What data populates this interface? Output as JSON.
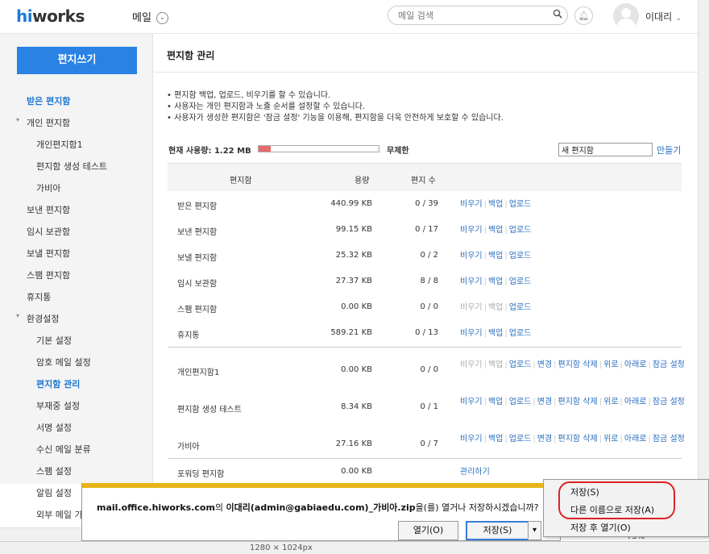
{
  "header": {
    "logo_hi": "hi",
    "logo_rest": "works",
    "mail_menu": "메일",
    "mail_menu_chevron": "chevron-down-icon",
    "search_placeholder": "메일 검색",
    "username": "이대리",
    "username_chevron": "⌄"
  },
  "sidebar": {
    "write_button": "편지쓰기",
    "items": [
      {
        "label": "받은 편지함",
        "level": 0,
        "active": true
      },
      {
        "label": "개인 편지함",
        "level": 0,
        "expander": "▾"
      },
      {
        "label": "개인편지함1",
        "level": 1
      },
      {
        "label": "편지함 생성 테스트",
        "level": 1
      },
      {
        "label": "가비아",
        "level": 1
      },
      {
        "label": "보낸 편지함",
        "level": 0
      },
      {
        "label": "임시 보관함",
        "level": 0
      },
      {
        "label": "보낼 편지함",
        "level": 0
      },
      {
        "label": "스팸 편지함",
        "level": 0
      },
      {
        "label": "휴지통",
        "level": 0
      },
      {
        "label": "환경설정",
        "level": 0,
        "expander": "▾"
      },
      {
        "label": "기본 설정",
        "level": 1
      },
      {
        "label": "암호 메일 설정",
        "level": 1
      },
      {
        "label": "편지함 관리",
        "level": 1,
        "active": true
      },
      {
        "label": "부재중 설정",
        "level": 1
      },
      {
        "label": "서명 설정",
        "level": 1
      },
      {
        "label": "수신 메일 분류",
        "level": 1
      },
      {
        "label": "스팸 설정",
        "level": 1
      },
      {
        "label": "알림 설정",
        "level": 1
      },
      {
        "label": "외부 메일 가",
        "level": 1
      }
    ]
  },
  "main": {
    "title": "편지함 관리",
    "notes": [
      "• 편지함 백업, 업로드, 비우기를 할 수 있습니다.",
      "• 사용자는 개인 편지함과 노출 순서를 설정할 수 있습니다.",
      "• 사용자가 생성한 편지함은 '잠금 설정' 기능을 이용해, 편지함을 더욱 안전하게 보호할 수 있습니다."
    ],
    "usage_label": "현재 사용량: 1.22 MB",
    "usage_fraction": 0.1,
    "unlimited": "무제한",
    "new_folder_value": "새 편지함",
    "make_link": "만들기",
    "columns": [
      "편지함",
      "용량",
      "편지 수"
    ],
    "rows": [
      {
        "name": "받은 편지함",
        "size": "440.99 KB",
        "count": "0 / 39",
        "actions": [
          {
            "t": "비우기",
            "on": true
          },
          {
            "t": "백업",
            "on": true
          },
          {
            "t": "업로드",
            "on": true
          }
        ]
      },
      {
        "name": "보낸 편지함",
        "size": "99.15 KB",
        "count": "0 / 17",
        "actions": [
          {
            "t": "비우기",
            "on": true
          },
          {
            "t": "백업",
            "on": true
          },
          {
            "t": "업로드",
            "on": true
          }
        ]
      },
      {
        "name": "보낼 편지함",
        "size": "25.32 KB",
        "count": "0 / 2",
        "actions": [
          {
            "t": "비우기",
            "on": true
          },
          {
            "t": "백업",
            "on": true
          },
          {
            "t": "업로드",
            "on": true
          }
        ]
      },
      {
        "name": "임시 보관함",
        "size": "27.37 KB",
        "count": "8 / 8",
        "actions": [
          {
            "t": "비우기",
            "on": true
          },
          {
            "t": "백업",
            "on": true
          },
          {
            "t": "업로드",
            "on": true
          }
        ]
      },
      {
        "name": "스팸 편지함",
        "size": "0.00 KB",
        "count": "0 / 0",
        "actions": [
          {
            "t": "비우기",
            "on": false
          },
          {
            "t": "백업",
            "on": false
          },
          {
            "t": "업로드",
            "on": true
          }
        ]
      },
      {
        "name": "휴지통",
        "size": "589.21 KB",
        "count": "0 / 13",
        "actions": [
          {
            "t": "비우기",
            "on": true
          },
          {
            "t": "백업",
            "on": true
          },
          {
            "t": "업로드",
            "on": true
          }
        ]
      },
      {
        "name": "개인편지함1",
        "size": "0.00 KB",
        "count": "0 / 0",
        "actions": [
          {
            "t": "비우기",
            "on": false
          },
          {
            "t": "백업",
            "on": false
          },
          {
            "t": "업로드",
            "on": true
          },
          {
            "t": "변경",
            "on": true
          },
          {
            "t": "편지함 삭제",
            "on": true
          },
          {
            "t": "위로",
            "on": true
          },
          {
            "t": "아래로",
            "on": true
          },
          {
            "t": "잠금 설정",
            "on": true
          }
        ]
      },
      {
        "name": "편지함 생성 테스트",
        "size": "8.34 KB",
        "count": "0 / 1",
        "actions": [
          {
            "t": "비우기",
            "on": true
          },
          {
            "t": "백업",
            "on": true
          },
          {
            "t": "업로드",
            "on": true
          },
          {
            "t": "변경",
            "on": true
          },
          {
            "t": "편지함 삭제",
            "on": true
          },
          {
            "t": "위로",
            "on": true
          },
          {
            "t": "아래로",
            "on": true
          },
          {
            "t": "잠금 설정",
            "on": true
          }
        ]
      },
      {
        "name": "가비아",
        "size": "27.16 KB",
        "count": "0 / 7",
        "actions": [
          {
            "t": "비우기",
            "on": true
          },
          {
            "t": "백업",
            "on": true
          },
          {
            "t": "업로드",
            "on": true
          },
          {
            "t": "변경",
            "on": true
          },
          {
            "t": "편지함 삭제",
            "on": true
          },
          {
            "t": "위로",
            "on": true
          },
          {
            "t": "아래로",
            "on": true
          },
          {
            "t": "잠금 설정",
            "on": true
          }
        ]
      },
      {
        "name": "포워딩 편지함",
        "size": "0.00 KB",
        "count": "",
        "actions": [
          {
            "t": "관리하기",
            "on": true
          }
        ]
      }
    ]
  },
  "download": {
    "host": "mail.office.hiworks.com",
    "text_mid": "의 ",
    "file": "이대리(admin@gabiaedu.com)_가비아.zip",
    "text_end": "을(를) 열거나 저장하시겠습니까?",
    "open_button": "열기(O)",
    "save_button": "저장(S)",
    "dropdown_arrow": "▾"
  },
  "context_menu": {
    "items": [
      "저장(S)",
      "다른 이름으로 저장(A)",
      "저장 후 열기(O)"
    ]
  },
  "statusbar": {
    "dimensions_text": "1280 × 1024px",
    "zoom_text": "75%"
  },
  "colors": {
    "accent": "#2a82e4",
    "usage_fill": "#e86a6a",
    "notify_bar": "#e7b416",
    "highlight": "#dd2222"
  }
}
